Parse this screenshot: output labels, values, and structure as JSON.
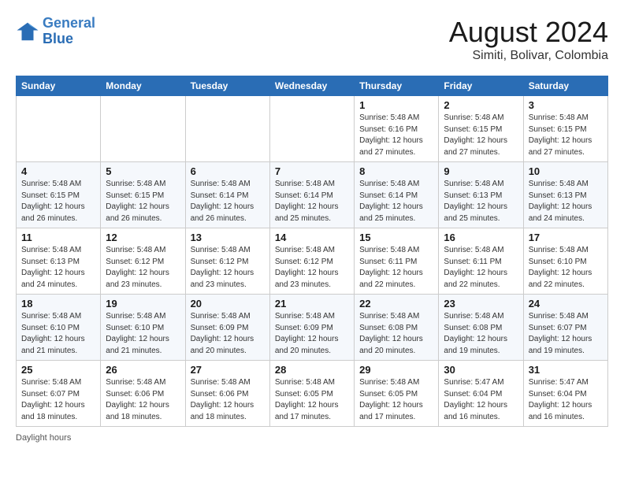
{
  "header": {
    "logo_line1": "General",
    "logo_line2": "Blue",
    "month_year": "August 2024",
    "location": "Simiti, Bolivar, Colombia"
  },
  "weekdays": [
    "Sunday",
    "Monday",
    "Tuesday",
    "Wednesday",
    "Thursday",
    "Friday",
    "Saturday"
  ],
  "weeks": [
    [
      {
        "day": "",
        "info": ""
      },
      {
        "day": "",
        "info": ""
      },
      {
        "day": "",
        "info": ""
      },
      {
        "day": "",
        "info": ""
      },
      {
        "day": "1",
        "info": "Sunrise: 5:48 AM\nSunset: 6:16 PM\nDaylight: 12 hours\nand 27 minutes."
      },
      {
        "day": "2",
        "info": "Sunrise: 5:48 AM\nSunset: 6:15 PM\nDaylight: 12 hours\nand 27 minutes."
      },
      {
        "day": "3",
        "info": "Sunrise: 5:48 AM\nSunset: 6:15 PM\nDaylight: 12 hours\nand 27 minutes."
      }
    ],
    [
      {
        "day": "4",
        "info": "Sunrise: 5:48 AM\nSunset: 6:15 PM\nDaylight: 12 hours\nand 26 minutes."
      },
      {
        "day": "5",
        "info": "Sunrise: 5:48 AM\nSunset: 6:15 PM\nDaylight: 12 hours\nand 26 minutes."
      },
      {
        "day": "6",
        "info": "Sunrise: 5:48 AM\nSunset: 6:14 PM\nDaylight: 12 hours\nand 26 minutes."
      },
      {
        "day": "7",
        "info": "Sunrise: 5:48 AM\nSunset: 6:14 PM\nDaylight: 12 hours\nand 25 minutes."
      },
      {
        "day": "8",
        "info": "Sunrise: 5:48 AM\nSunset: 6:14 PM\nDaylight: 12 hours\nand 25 minutes."
      },
      {
        "day": "9",
        "info": "Sunrise: 5:48 AM\nSunset: 6:13 PM\nDaylight: 12 hours\nand 25 minutes."
      },
      {
        "day": "10",
        "info": "Sunrise: 5:48 AM\nSunset: 6:13 PM\nDaylight: 12 hours\nand 24 minutes."
      }
    ],
    [
      {
        "day": "11",
        "info": "Sunrise: 5:48 AM\nSunset: 6:13 PM\nDaylight: 12 hours\nand 24 minutes."
      },
      {
        "day": "12",
        "info": "Sunrise: 5:48 AM\nSunset: 6:12 PM\nDaylight: 12 hours\nand 23 minutes."
      },
      {
        "day": "13",
        "info": "Sunrise: 5:48 AM\nSunset: 6:12 PM\nDaylight: 12 hours\nand 23 minutes."
      },
      {
        "day": "14",
        "info": "Sunrise: 5:48 AM\nSunset: 6:12 PM\nDaylight: 12 hours\nand 23 minutes."
      },
      {
        "day": "15",
        "info": "Sunrise: 5:48 AM\nSunset: 6:11 PM\nDaylight: 12 hours\nand 22 minutes."
      },
      {
        "day": "16",
        "info": "Sunrise: 5:48 AM\nSunset: 6:11 PM\nDaylight: 12 hours\nand 22 minutes."
      },
      {
        "day": "17",
        "info": "Sunrise: 5:48 AM\nSunset: 6:10 PM\nDaylight: 12 hours\nand 22 minutes."
      }
    ],
    [
      {
        "day": "18",
        "info": "Sunrise: 5:48 AM\nSunset: 6:10 PM\nDaylight: 12 hours\nand 21 minutes."
      },
      {
        "day": "19",
        "info": "Sunrise: 5:48 AM\nSunset: 6:10 PM\nDaylight: 12 hours\nand 21 minutes."
      },
      {
        "day": "20",
        "info": "Sunrise: 5:48 AM\nSunset: 6:09 PM\nDaylight: 12 hours\nand 20 minutes."
      },
      {
        "day": "21",
        "info": "Sunrise: 5:48 AM\nSunset: 6:09 PM\nDaylight: 12 hours\nand 20 minutes."
      },
      {
        "day": "22",
        "info": "Sunrise: 5:48 AM\nSunset: 6:08 PM\nDaylight: 12 hours\nand 20 minutes."
      },
      {
        "day": "23",
        "info": "Sunrise: 5:48 AM\nSunset: 6:08 PM\nDaylight: 12 hours\nand 19 minutes."
      },
      {
        "day": "24",
        "info": "Sunrise: 5:48 AM\nSunset: 6:07 PM\nDaylight: 12 hours\nand 19 minutes."
      }
    ],
    [
      {
        "day": "25",
        "info": "Sunrise: 5:48 AM\nSunset: 6:07 PM\nDaylight: 12 hours\nand 18 minutes."
      },
      {
        "day": "26",
        "info": "Sunrise: 5:48 AM\nSunset: 6:06 PM\nDaylight: 12 hours\nand 18 minutes."
      },
      {
        "day": "27",
        "info": "Sunrise: 5:48 AM\nSunset: 6:06 PM\nDaylight: 12 hours\nand 18 minutes."
      },
      {
        "day": "28",
        "info": "Sunrise: 5:48 AM\nSunset: 6:05 PM\nDaylight: 12 hours\nand 17 minutes."
      },
      {
        "day": "29",
        "info": "Sunrise: 5:48 AM\nSunset: 6:05 PM\nDaylight: 12 hours\nand 17 minutes."
      },
      {
        "day": "30",
        "info": "Sunrise: 5:47 AM\nSunset: 6:04 PM\nDaylight: 12 hours\nand 16 minutes."
      },
      {
        "day": "31",
        "info": "Sunrise: 5:47 AM\nSunset: 6:04 PM\nDaylight: 12 hours\nand 16 minutes."
      }
    ]
  ],
  "footer": "Daylight hours"
}
